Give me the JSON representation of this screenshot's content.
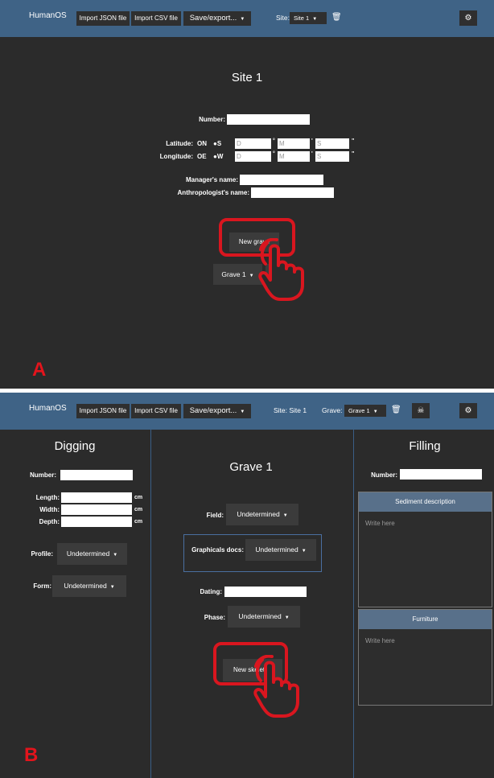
{
  "navbar": {
    "brand": "HumanOS",
    "import_json": "Import JSON file",
    "import_csv": "Import CSV file",
    "save_export": "Save/export...",
    "site_label": "Site:",
    "site_value": "Site 1",
    "site_text_b": "Site: Site 1",
    "grave_label": "Grave:",
    "grave_value": "Grave 1",
    "settings_icon": "gear-icon",
    "trash_icon": "trash-icon",
    "skeleton_icon": "skeleton-icon"
  },
  "panel_a": {
    "tag": "A",
    "title": "Site 1",
    "number_label": "Number:",
    "latitude_label": "Latitude:",
    "longitude_label": "Longitude:",
    "lat_radio_1": "ON",
    "lat_radio_2": "S",
    "lon_radio_1": "OE",
    "lon_radio_2": "W",
    "ph_degrees": "D",
    "ph_minutes": "M",
    "ph_seconds": "S",
    "deg_symbol": "°",
    "min_symbol": "'",
    "sec_symbol": "\"",
    "manager_label": "Manager's name:",
    "anthropologist_label": "Anthropologist's name:",
    "new_grave": "New grave",
    "grave_select": "Grave 1",
    "accent_color": "#d9161f"
  },
  "panel_b": {
    "tag": "B",
    "digging": {
      "title": "Digging",
      "number_label": "Number:",
      "length_label": "Length:",
      "width_label": "Width:",
      "depth_label": "Depth:",
      "unit": "cm",
      "profile_label": "Profile:",
      "profile_value": "Undetermined",
      "form_label": "Form:",
      "form_value": "Undetermined"
    },
    "grave": {
      "title": "Grave 1",
      "field_label": "Field:",
      "field_value": "Undetermined",
      "docs_label": "Graphicals docs:",
      "docs_value": "Undetermined",
      "dating_label": "Dating:",
      "phase_label": "Phase:",
      "phase_value": "Undetermined",
      "new_skeleton": "New skeleton"
    },
    "filling": {
      "title": "Filling",
      "number_label": "Number:",
      "sediment_header": "Sediment description",
      "sediment_placeholder": "Write here",
      "furniture_header": "Furniture",
      "furniture_placeholder": "Write here"
    }
  }
}
